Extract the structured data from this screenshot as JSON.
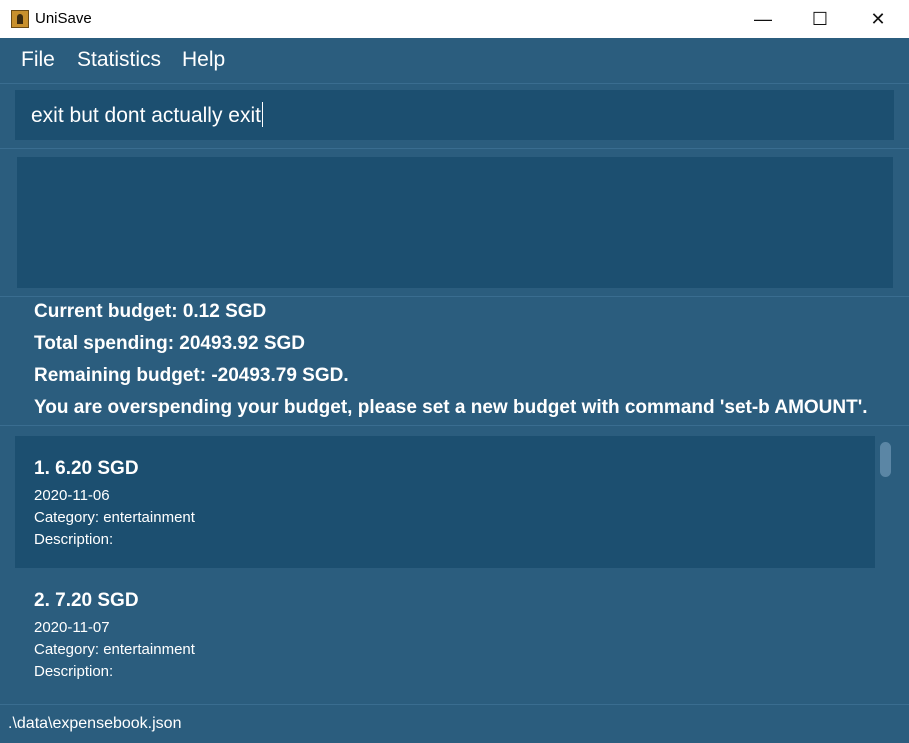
{
  "window": {
    "title": "UniSave",
    "minimize_glyph": "—",
    "maximize_glyph": "☐",
    "close_glyph": "✕"
  },
  "menu": [
    "File",
    "Statistics",
    "Help"
  ],
  "command": {
    "value": "exit but dont actually exit"
  },
  "result": {
    "text": ""
  },
  "budget": {
    "current": "Current budget: 0.12 SGD",
    "total_spending": "Total spending: 20493.92 SGD",
    "remaining": "Remaining budget: -20493.79 SGD.",
    "warning": "You are overspending your budget, please set a new budget with command 'set-b AMOUNT'."
  },
  "expenses": [
    {
      "header": "1.  6.20 SGD",
      "date": "2020-11-06",
      "category": "Category: entertainment",
      "description": "Description:"
    },
    {
      "header": "2.  7.20 SGD",
      "date": "2020-11-07",
      "category": "Category: entertainment",
      "description": "Description:"
    }
  ],
  "status": {
    "file_path": ".\\data\\expensebook.json"
  },
  "colors": {
    "background": "#2b5d7e",
    "panel": "#1c4f70",
    "text": "#ffffff"
  }
}
